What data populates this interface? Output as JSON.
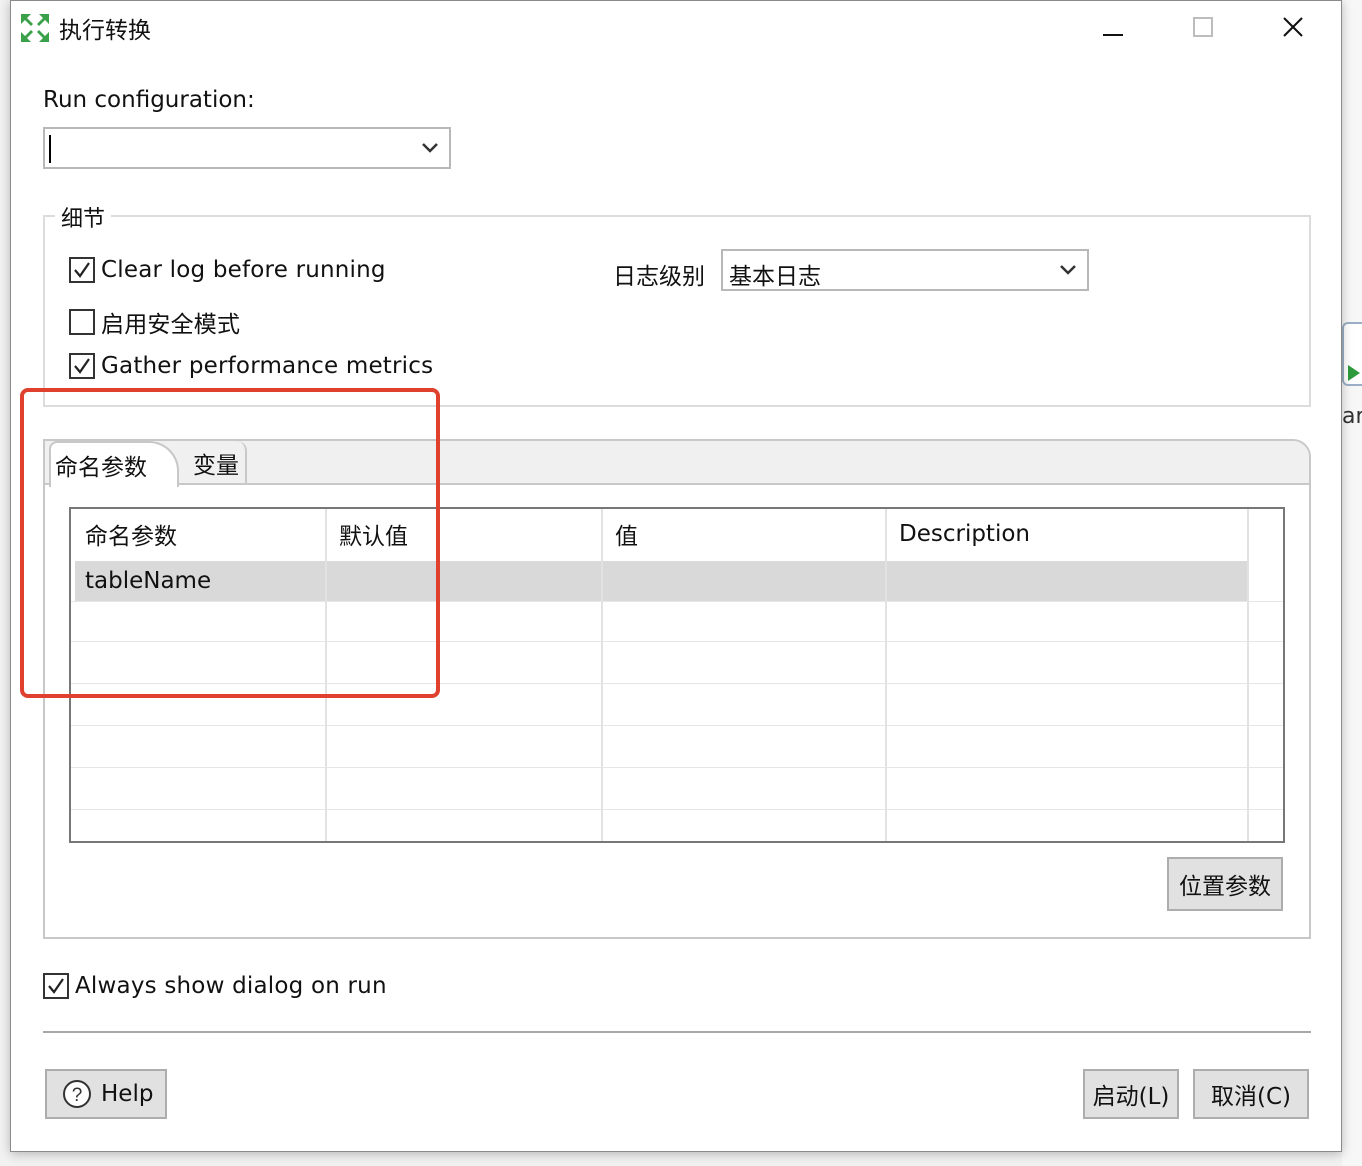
{
  "window": {
    "title": "执行转换"
  },
  "run_configuration": {
    "label": "Run configuration:",
    "value": ""
  },
  "details": {
    "group_title": "细节",
    "clear_log": {
      "label": "Clear log before running",
      "checked": true
    },
    "safe_mode": {
      "label": "启用安全模式",
      "checked": false
    },
    "gather_metrics": {
      "label": "Gather performance metrics",
      "checked": true
    },
    "log_level": {
      "label": "日志级别",
      "value": "基本日志"
    }
  },
  "tabs": [
    {
      "label": "命名参数",
      "active": true
    },
    {
      "label": "变量",
      "active": false
    }
  ],
  "params_table": {
    "columns": [
      "命名参数",
      "默认值",
      "值",
      "Description"
    ],
    "rows": [
      {
        "name": "tableName",
        "default": "",
        "value": "",
        "description": ""
      }
    ]
  },
  "positional_params_button": "位置参数",
  "always_show": {
    "label": "Always show dialog on run",
    "checked": true
  },
  "footer": {
    "help": "Help",
    "launch": "启动(L)",
    "cancel": "取消(C)"
  },
  "background_fragment": "art",
  "colors": {
    "highlight": "#e0412f",
    "selected_row": "#d9d9d9",
    "app_icon": "#3aa04a"
  }
}
